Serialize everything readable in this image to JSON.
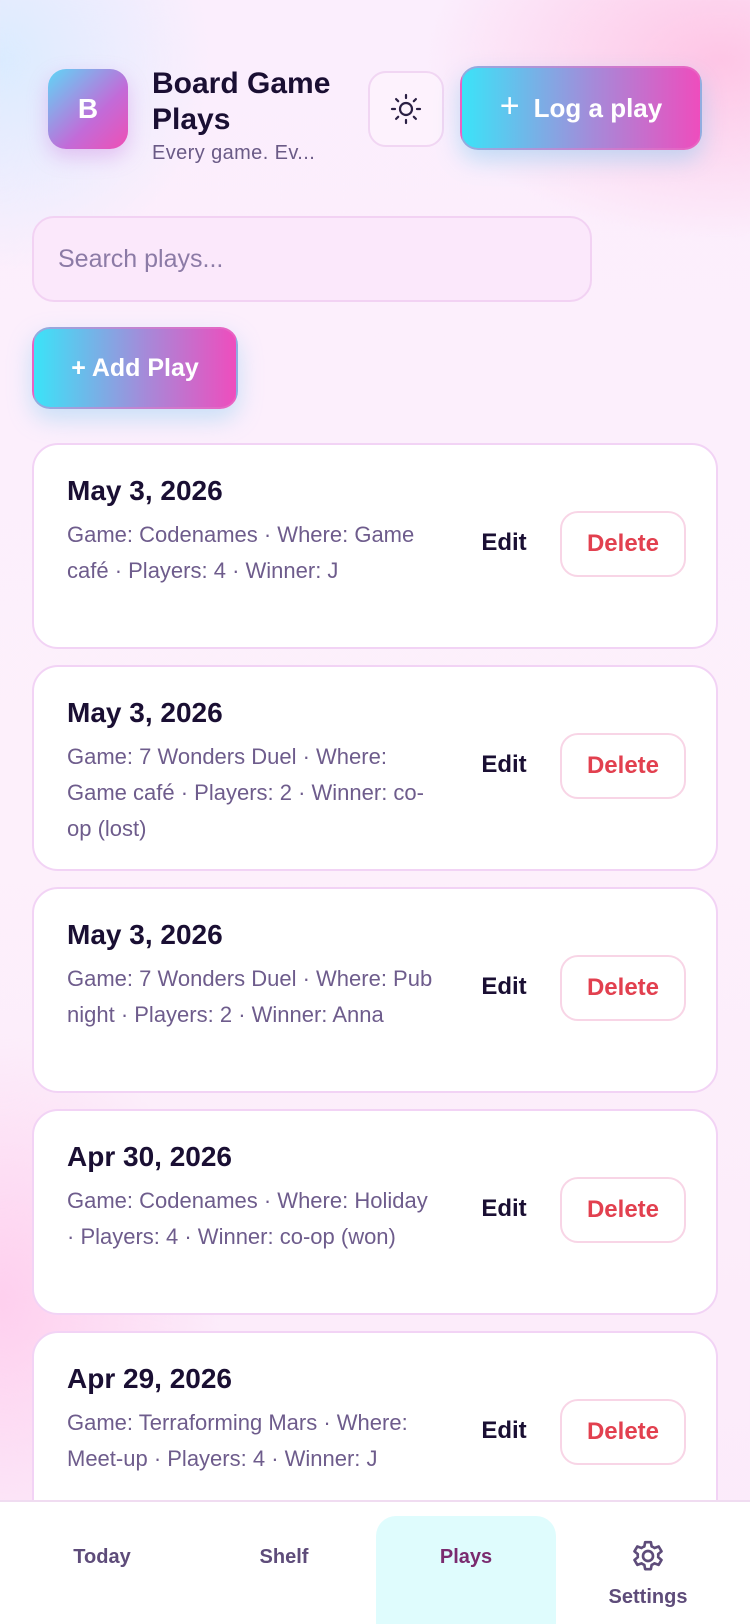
{
  "header": {
    "logo_letter": "B",
    "title": "Board Game Plays",
    "subtitle": "Every game. Ev...",
    "theme_icon": "sun-icon",
    "log_button": "Log a play"
  },
  "search": {
    "placeholder": "Search plays..."
  },
  "add_button": "+ Add Play",
  "plays": [
    {
      "date": "May 3, 2026",
      "meta": "Game: Codenames · Where: Game café · Players: 4 · Winner: J",
      "edit": "Edit",
      "delete": "Delete"
    },
    {
      "date": "May 3, 2026",
      "meta": "Game: 7 Wonders Duel · Where: Game café · Players: 2 · Winner: co-op (lost)",
      "edit": "Edit",
      "delete": "Delete"
    },
    {
      "date": "May 3, 2026",
      "meta": "Game: 7 Wonders Duel · Where: Pub night · Players: 2 · Winner: Anna",
      "edit": "Edit",
      "delete": "Delete"
    },
    {
      "date": "Apr 30, 2026",
      "meta": "Game: Codenames · Where: Holiday · Players: 4 · Winner: co-op (won)",
      "edit": "Edit",
      "delete": "Delete"
    },
    {
      "date": "Apr 29, 2026",
      "meta": "Game: Terraforming Mars · Where: Meet-up · Players: 4 · Winner: J",
      "edit": "Edit",
      "delete": "Delete"
    }
  ],
  "nav": {
    "today": "Today",
    "shelf": "Shelf",
    "plays": "Plays",
    "settings": "Settings",
    "active": "Plays"
  },
  "colors": {
    "accent_cyan": "#3be3f8",
    "accent_pink": "#ee4dbd",
    "delete_red": "#e2404f",
    "active_tab_bg": "#dffcfd"
  }
}
